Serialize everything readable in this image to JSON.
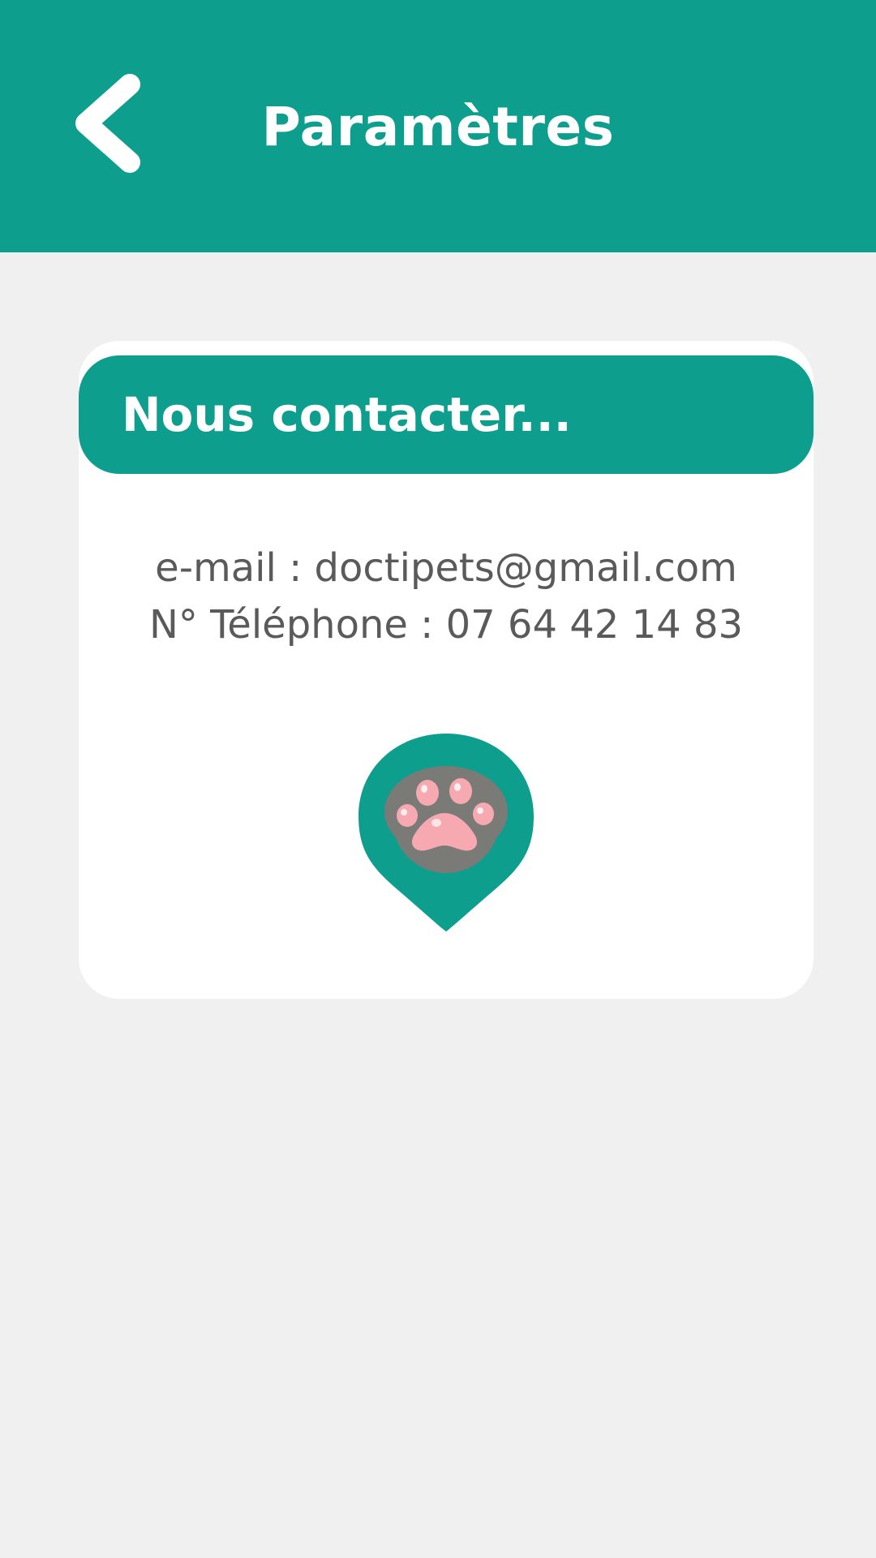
{
  "header": {
    "title": "Paramètres",
    "back_icon": "chevron-left-icon",
    "background_color": "#0e9e8e"
  },
  "contact_card": {
    "title": "Nous contacter...",
    "email_line": "e-mail : doctipets@gmail.com",
    "phone_line": "N° Téléphone : 07 64 42 14 83",
    "logo_icon": "paw-pin-logo-icon"
  },
  "colors": {
    "accent": "#0e9e8e",
    "background": "#f0f0f0",
    "card": "#ffffff",
    "text": "#5a5a5a",
    "paw_gray": "#7a7a76",
    "paw_pink": "#f7a9b1"
  }
}
